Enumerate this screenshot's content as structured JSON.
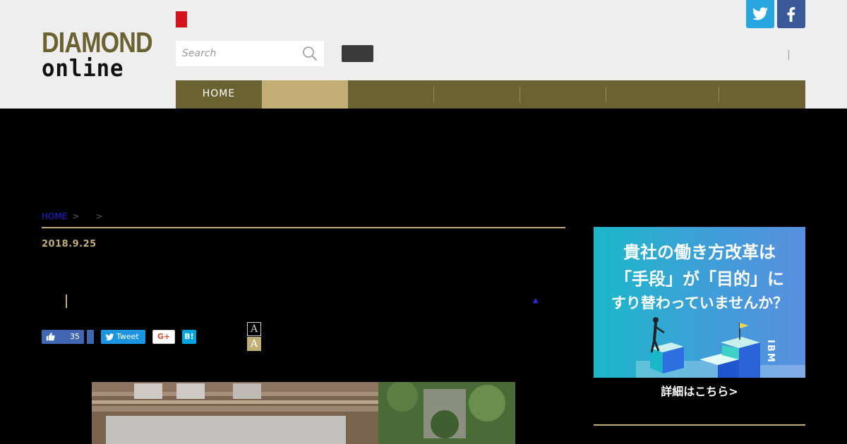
{
  "header": {
    "logo_top": "DIAMOND",
    "logo_bottom": "online",
    "search_placeholder": "Search",
    "social": {
      "twitter_icon": "twitter-icon",
      "facebook_icon": "facebook-icon"
    }
  },
  "nav": {
    "items": [
      {
        "label": "HOME"
      },
      {
        "label": ""
      },
      {
        "label": ""
      },
      {
        "label": ""
      },
      {
        "label": ""
      },
      {
        "label": ""
      },
      {
        "label": ""
      }
    ],
    "active_index": 1
  },
  "article": {
    "breadcrumb_home": "HOME",
    "date": "2018.9.25",
    "like_count": "35",
    "tweet_label": "Tweet",
    "gplus_label": "G+",
    "hatena_label": "B!",
    "font_small_label": "A",
    "font_large_label": "A"
  },
  "ad": {
    "line1": "貴社の働き方改革は",
    "line2": "「手段」が「目的」に",
    "line3": "すり替わっていませんか？",
    "brand": "IBM",
    "cta": "詳細はこちら>"
  },
  "colors": {
    "brand_olive": "#6b6232",
    "accent_gold": "#c2ae74",
    "twitter_blue": "#27a5df",
    "facebook_blue": "#3b5998"
  }
}
